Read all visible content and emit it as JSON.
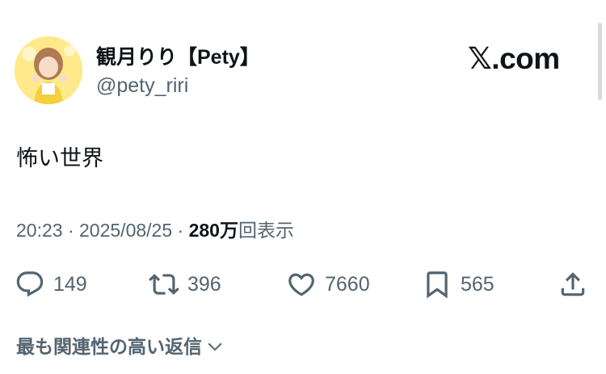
{
  "author": {
    "display_name": "観月りり【Pety】",
    "handle": "@pety_riri"
  },
  "brand": "𝕏.com",
  "tweet": {
    "text": "怖い世界",
    "time": "20:23",
    "date": "2025/08/25",
    "views_count": "280万",
    "views_label": "回表示"
  },
  "actions": {
    "replies": "149",
    "reposts": "396",
    "likes": "7660",
    "bookmarks": "565"
  },
  "replies_sort": {
    "label": "最も関連性の高い返信"
  },
  "icons": [
    "reply-icon",
    "repost-icon",
    "like-icon",
    "bookmark-icon",
    "share-icon",
    "chevron-down-icon"
  ]
}
